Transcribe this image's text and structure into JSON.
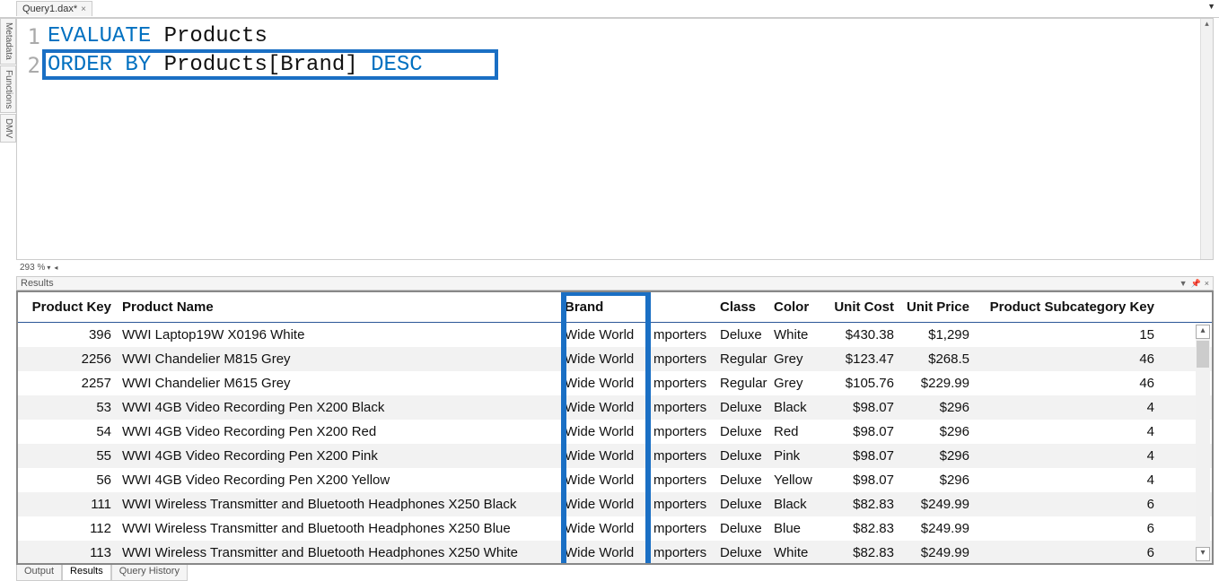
{
  "tabs": {
    "file": "Query1.dax*",
    "close_x": "×"
  },
  "side_tabs": [
    "Metadata",
    "Functions",
    "DMV"
  ],
  "editor": {
    "lines": [
      {
        "n": "1",
        "tokens": [
          {
            "t": "EVALUATE",
            "cls": "kw"
          },
          {
            "t": " ",
            "cls": ""
          },
          {
            "t": "Products",
            "cls": "ident"
          }
        ]
      },
      {
        "n": "2",
        "tokens": [
          {
            "t": "ORDER BY",
            "cls": "kw"
          },
          {
            "t": " ",
            "cls": ""
          },
          {
            "t": "Products[Brand]",
            "cls": "ident"
          },
          {
            "t": " ",
            "cls": ""
          },
          {
            "t": "DESC",
            "cls": "kw"
          }
        ]
      }
    ],
    "zoom": "293 %"
  },
  "results_panel": {
    "title": "Results"
  },
  "columns": {
    "key": "Product Key",
    "name": "Product Name",
    "brand": "Brand",
    "class": "Class",
    "color": "Color",
    "ucost": "Unit Cost",
    "uprice": "Unit Price",
    "subkey": "Product Subcategory Key"
  },
  "rows": [
    {
      "key": "396",
      "name": "WWI Laptop19W X0196 White",
      "brand1": "Wide World",
      "brand2": "mporters",
      "class": "Deluxe",
      "color": "White",
      "ucost": "$430.38",
      "uprice": "$1,299",
      "subkey": "15"
    },
    {
      "key": "2256",
      "name": "WWI Chandelier M815 Grey",
      "brand1": "Wide World",
      "brand2": "mporters",
      "class": "Regular",
      "color": "Grey",
      "ucost": "$123.47",
      "uprice": "$268.5",
      "subkey": "46"
    },
    {
      "key": "2257",
      "name": "WWI Chandelier M615 Grey",
      "brand1": "Wide World",
      "brand2": "mporters",
      "class": "Regular",
      "color": "Grey",
      "ucost": "$105.76",
      "uprice": "$229.99",
      "subkey": "46"
    },
    {
      "key": "53",
      "name": "WWI 4GB Video Recording Pen X200 Black",
      "brand1": "Wide World",
      "brand2": "mporters",
      "class": "Deluxe",
      "color": "Black",
      "ucost": "$98.07",
      "uprice": "$296",
      "subkey": "4"
    },
    {
      "key": "54",
      "name": "WWI 4GB Video Recording Pen X200 Red",
      "brand1": "Wide World",
      "brand2": "mporters",
      "class": "Deluxe",
      "color": "Red",
      "ucost": "$98.07",
      "uprice": "$296",
      "subkey": "4"
    },
    {
      "key": "55",
      "name": "WWI 4GB Video Recording Pen X200 Pink",
      "brand1": "Wide World",
      "brand2": "mporters",
      "class": "Deluxe",
      "color": "Pink",
      "ucost": "$98.07",
      "uprice": "$296",
      "subkey": "4"
    },
    {
      "key": "56",
      "name": "WWI 4GB Video Recording Pen X200 Yellow",
      "brand1": "Wide World",
      "brand2": "mporters",
      "class": "Deluxe",
      "color": "Yellow",
      "ucost": "$98.07",
      "uprice": "$296",
      "subkey": "4"
    },
    {
      "key": "111",
      "name": "WWI Wireless Transmitter and Bluetooth Headphones X250 Black",
      "brand1": "Wide World",
      "brand2": "mporters",
      "class": "Deluxe",
      "color": "Black",
      "ucost": "$82.83",
      "uprice": "$249.99",
      "subkey": "6"
    },
    {
      "key": "112",
      "name": "WWI Wireless Transmitter and Bluetooth Headphones X250 Blue",
      "brand1": "Wide World",
      "brand2": "mporters",
      "class": "Deluxe",
      "color": "Blue",
      "ucost": "$82.83",
      "uprice": "$249.99",
      "subkey": "6"
    },
    {
      "key": "113",
      "name": "WWI Wireless Transmitter and Bluetooth Headphones X250 White",
      "brand1": "Wide World",
      "brand2": "mporters",
      "class": "Deluxe",
      "color": "White",
      "ucost": "$82.83",
      "uprice": "$249.99",
      "subkey": "6"
    }
  ],
  "bottom_tabs": {
    "output": "Output",
    "results": "Results",
    "history": "Query History"
  }
}
